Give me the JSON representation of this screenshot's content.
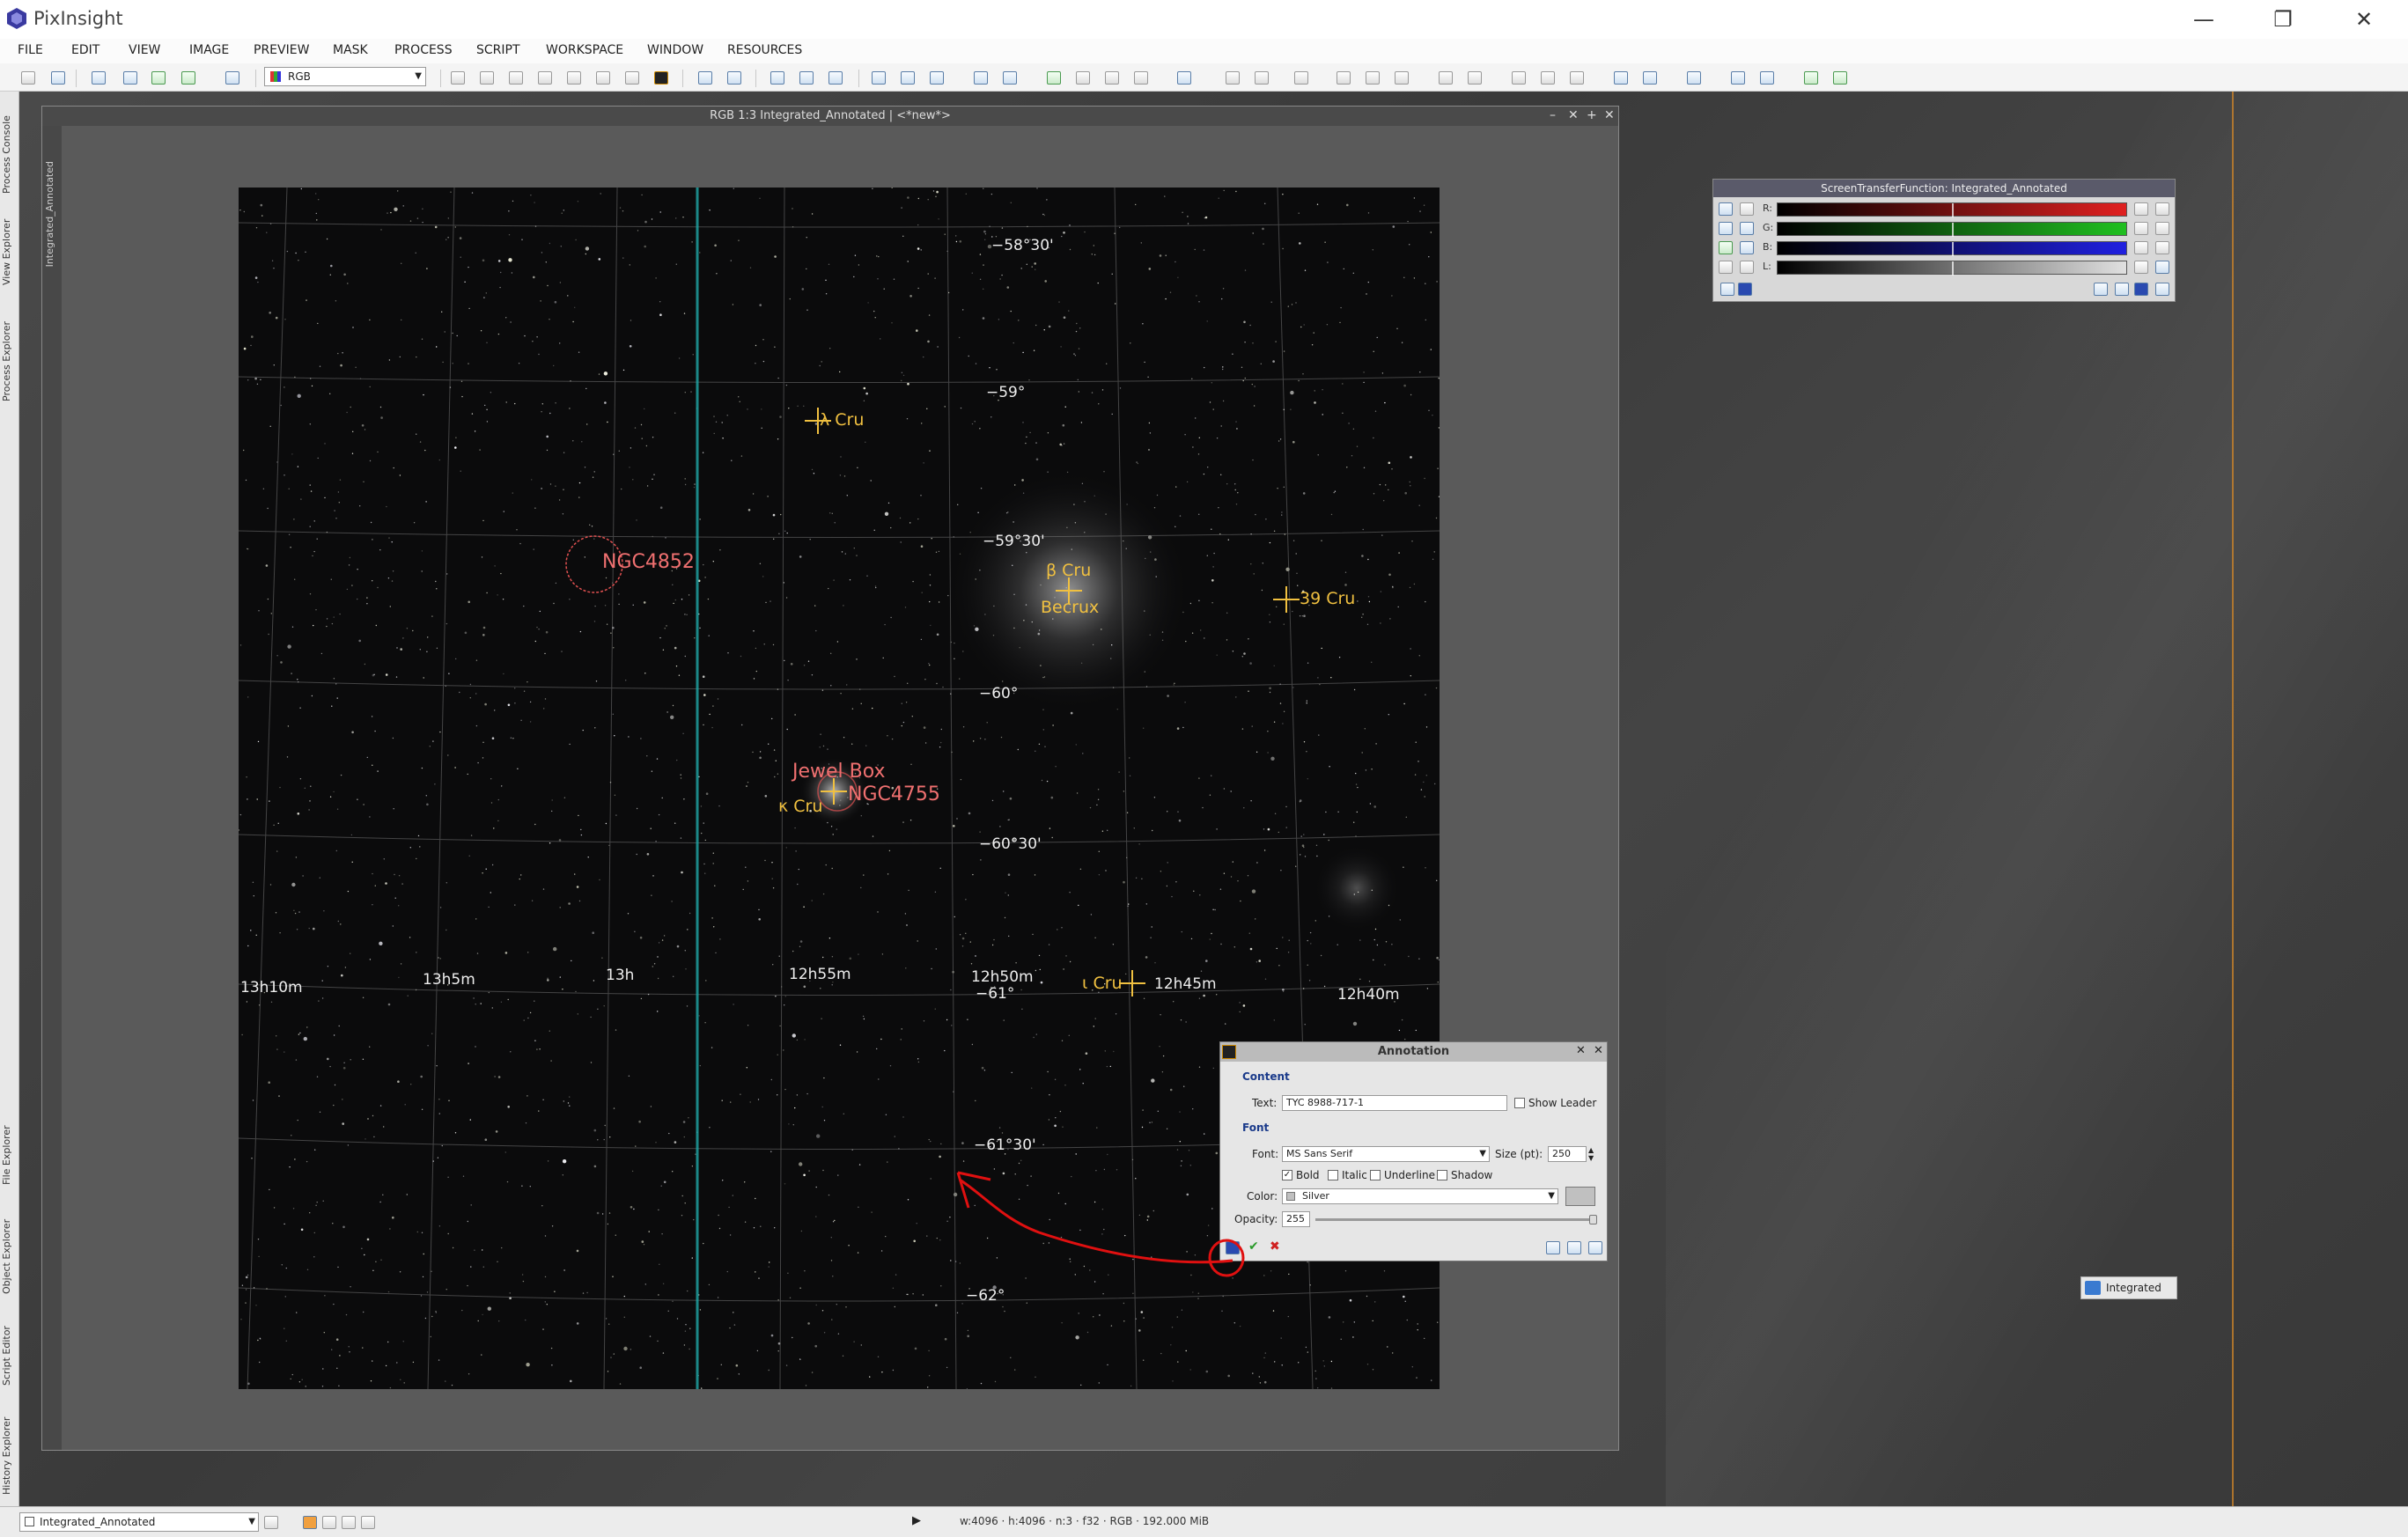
{
  "app": {
    "title": "PixInsight",
    "minimize_glyph": "—",
    "restore_glyph": "❐",
    "close_glyph": "✕"
  },
  "menu": [
    "FILE",
    "EDIT",
    "VIEW",
    "IMAGE",
    "PREVIEW",
    "MASK",
    "PROCESS",
    "SCRIPT",
    "WORKSPACE",
    "WINDOW",
    "RESOURCES"
  ],
  "toolbar": {
    "channel_select": "RGB"
  },
  "left_tabs": [
    "Process Console",
    "View Explorer",
    "Process Explorer",
    "File Explorer",
    "Object Explorer",
    "Script Editor",
    "History Explorer"
  ],
  "image_window": {
    "title": "RGB 1:3 Integrated_Annotated | <*new*>",
    "side_tab": "Integrated_Annotated"
  },
  "sky": {
    "dec_labels": [
      "−58°30'",
      "−59°",
      "−59°30'",
      "−60°",
      "−60°30'",
      "−61°",
      "−61°30'",
      "−62°"
    ],
    "ra_labels": [
      "13h10m",
      "13h5m",
      "13h",
      "12h55m",
      "12h50m",
      "12h45m",
      "12h40m"
    ],
    "stars": {
      "lambda_cru": "λ Cru",
      "beta_cru": "β Cru",
      "becrux": "Becrux",
      "cru39": "39 Cru",
      "kappa_cru": "κ Cru",
      "iota_cru": "ι Cru"
    },
    "objects": {
      "ngc4852": "NGC4852",
      "jewel_box": "Jewel Box",
      "ngc4755": "NGC4755"
    }
  },
  "stf": {
    "title": "ScreenTransferFunction: Integrated_Annotated",
    "channels": [
      "R:",
      "G:",
      "B:",
      "L:"
    ],
    "colors": [
      "#e02020",
      "#20c020",
      "#2020e0",
      "#e0e0e0"
    ]
  },
  "annotation": {
    "title": "Annotation",
    "content_group": "Content",
    "text_label": "Text:",
    "text_value": "TYC 8988-717-1",
    "show_leader": "Show Leader",
    "font_group": "Font",
    "font_label": "Font:",
    "font_value": "MS Sans Serif",
    "size_label": "Size (pt):",
    "size_value": "250",
    "bold": "Bold",
    "italic": "Italic",
    "underline": "Underline",
    "shadow": "Shadow",
    "color_label": "Color:",
    "color_value": "Silver",
    "opacity_label": "Opacity:",
    "opacity_value": "255"
  },
  "status": {
    "view": "Integrated_Annotated",
    "info": "w:4096 · h:4096 · n:3 · f32 · RGB · 192.000 MiB"
  },
  "desktop_icon": {
    "label": "Integrated"
  }
}
